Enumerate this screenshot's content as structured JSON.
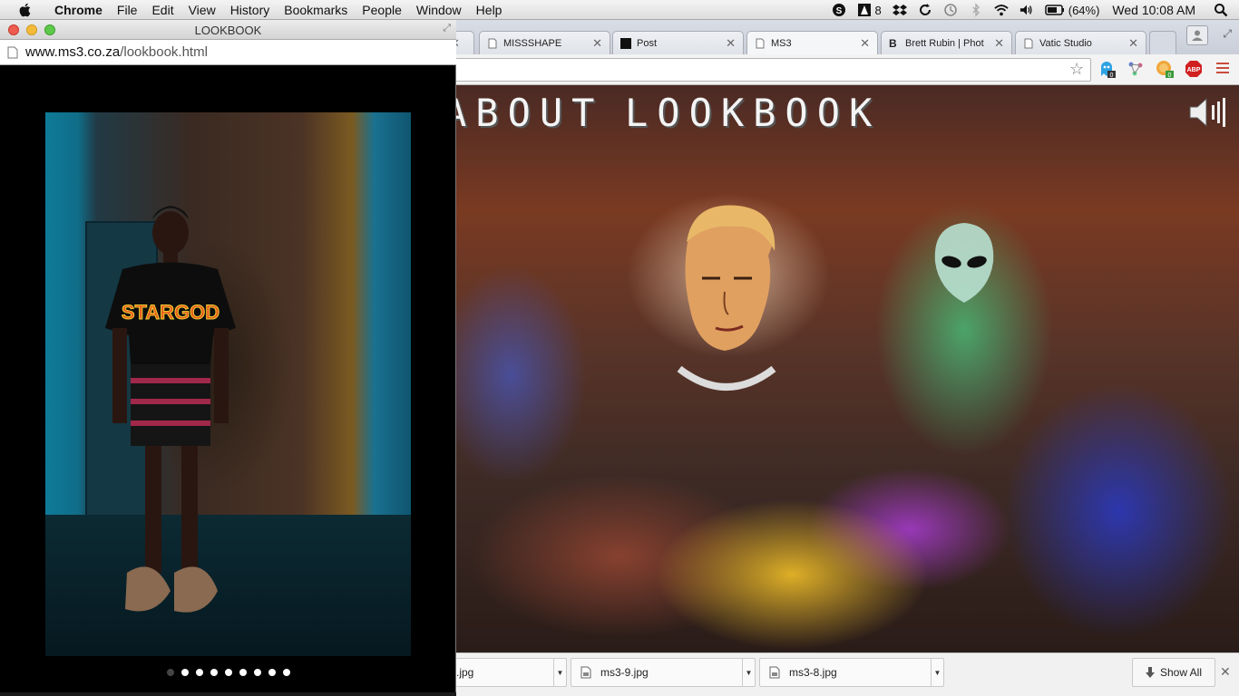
{
  "menubar": {
    "items": [
      "Chrome",
      "File",
      "Edit",
      "View",
      "History",
      "Bookmarks",
      "People",
      "Window",
      "Help"
    ],
    "tray": {
      "adobe_count": "8",
      "battery": "(64%)",
      "clock": "Wed 10:08 AM"
    },
    "icons": [
      "apple-icon",
      "skype-icon",
      "adobe-icon",
      "dropbox-icon",
      "sync-icon",
      "time-machine-icon",
      "bluetooth-icon",
      "wifi-icon",
      "volume-icon",
      "battery-icon",
      "spotlight-icon"
    ]
  },
  "browser": {
    "tabs": [
      {
        "label": "MISSSHAPE"
      },
      {
        "label": "Post"
      },
      {
        "label": "MS3"
      },
      {
        "label": "Brett Rubin | Phot"
      },
      {
        "label": "Vatic Studio"
      }
    ],
    "extensions": {
      "ghostery_count": "0",
      "extension_count": "0",
      "adblock_label": "ABP"
    }
  },
  "site": {
    "nav": {
      "about": "ABOUT",
      "lookbook": "LOOKBOOK"
    }
  },
  "popup": {
    "title": "LOOKBOOK",
    "url_host": "www.ms3.co.za",
    "url_path": "/lookbook.html",
    "shirt_text": "STARGOD",
    "slide_count": 9,
    "active_slide": 0
  },
  "downloads": {
    "items": [
      {
        "name": ".jpg"
      },
      {
        "name": "ms3-9.jpg"
      },
      {
        "name": "ms3-8.jpg"
      }
    ],
    "show_all": "Show All"
  },
  "colors": {
    "accent": "#c94c3c",
    "page_bg": "#000000",
    "tab_bg": "#e4e7ec"
  }
}
